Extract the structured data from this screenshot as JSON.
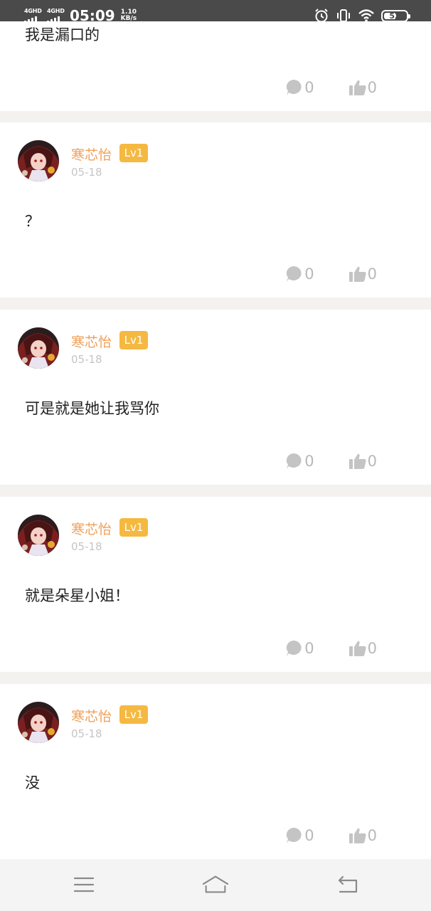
{
  "status_bar": {
    "net1": "4GHD",
    "net2": "4GHD",
    "time": "05:09",
    "speed_value": "1.10",
    "speed_unit": "KB/s",
    "battery": "52"
  },
  "top_partial_post": {
    "content": "我是漏口的",
    "comments": "0",
    "likes": "0"
  },
  "posts": [
    {
      "username": "寒芯怡",
      "level": "Lv1",
      "date": "05-18",
      "content": "？",
      "comments": "0",
      "likes": "0"
    },
    {
      "username": "寒芯怡",
      "level": "Lv1",
      "date": "05-18",
      "content": "可是就是她让我骂你",
      "comments": "0",
      "likes": "0"
    },
    {
      "username": "寒芯怡",
      "level": "Lv1",
      "date": "05-18",
      "content": "就是朵星小姐！",
      "comments": "0",
      "likes": "0"
    },
    {
      "username": "寒芯怡",
      "level": "Lv1",
      "date": "05-18",
      "content": "没",
      "comments": "0",
      "likes": "0"
    }
  ],
  "icons": {
    "comment": "comment-bubble-icon",
    "like": "thumbs-up-icon",
    "menu": "menu-icon",
    "home": "home-icon",
    "back": "back-icon"
  },
  "colors": {
    "username": "#f0a05a",
    "level_badge": "#f5b941",
    "status_bar": "#4a4a4a",
    "separator": "#f3f2ee"
  }
}
